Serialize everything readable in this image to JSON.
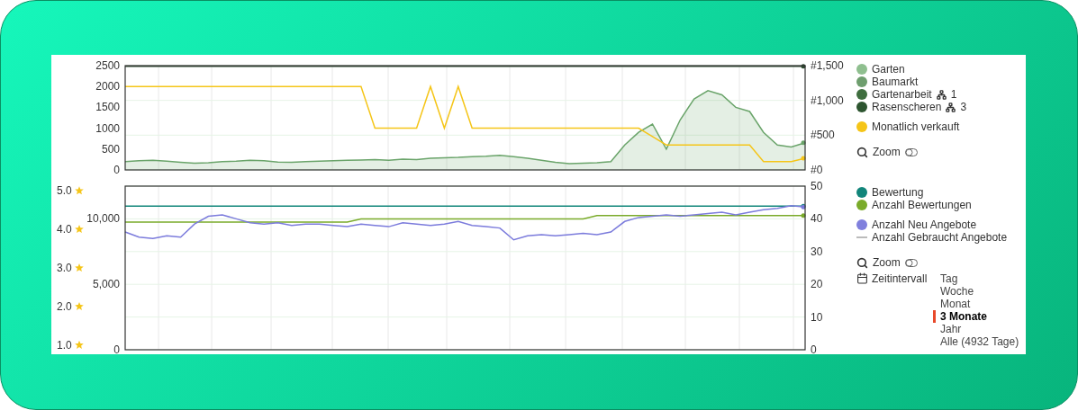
{
  "sales_chart": {
    "chart_data": {
      "type": "line",
      "grid": true,
      "ylim": [
        0,
        2500
      ],
      "yticks": [
        0,
        500,
        1000,
        1500,
        2000,
        2500
      ],
      "y2lim": [
        0,
        1500
      ],
      "y2ticks": [
        {
          "value": 0,
          "label": "#0"
        },
        {
          "value": 500,
          "label": "#500"
        },
        {
          "value": 1000,
          "label": "#1,000"
        },
        {
          "value": 1500,
          "label": "#1,500"
        }
      ],
      "series": [
        {
          "color": "#6aa46a",
          "type": "area",
          "values": [
            200,
            220,
            230,
            210,
            180,
            160,
            170,
            200,
            210,
            230,
            220,
            190,
            180,
            200,
            210,
            220,
            230,
            240,
            250,
            230,
            260,
            250,
            280,
            290,
            300,
            320,
            330,
            350,
            320,
            280,
            230,
            180,
            150,
            160,
            170,
            200,
            600,
            900,
            1100,
            500,
            1200,
            1700,
            1900,
            1800,
            1500,
            1400,
            900,
            600,
            550,
            650
          ]
        },
        {
          "color": "#2d4a30",
          "axis": "y2",
          "values": [
            1490,
            1490,
            1490,
            1490,
            1490,
            1490,
            1490,
            1490,
            1490,
            1490,
            1490,
            1490,
            1490,
            1490,
            1490,
            1490,
            1490,
            1490,
            1490,
            1490,
            1490,
            1490,
            1490,
            1490,
            1490,
            1490,
            1490,
            1490,
            1490,
            1490,
            1490,
            1490,
            1490,
            1490,
            1490,
            1490,
            1490,
            1490,
            1490,
            1490,
            1490,
            1490,
            1490,
            1490,
            1490,
            1490,
            1490,
            1490,
            1490,
            1490
          ]
        },
        {
          "color": "#f5c518",
          "values": [
            2000,
            2000,
            2000,
            2000,
            2000,
            2000,
            2000,
            2000,
            2000,
            2000,
            2000,
            2000,
            2000,
            2000,
            2000,
            2000,
            2000,
            2000,
            1000,
            1000,
            1000,
            1000,
            2000,
            1000,
            2000,
            1000,
            1000,
            1000,
            1000,
            1000,
            1000,
            1000,
            1000,
            1000,
            1000,
            1000,
            1000,
            1000,
            800,
            600,
            600,
            600,
            600,
            600,
            600,
            600,
            200,
            200,
            200,
            280
          ]
        }
      ]
    }
  },
  "sales_legend": {
    "groups": [
      [
        {
          "label": "Garten",
          "color": "#8fbf8f"
        },
        {
          "label": "Baumarkt",
          "color": "#6e9e6e"
        },
        {
          "label": "Gartenarbeit",
          "color": "#3f6e3f",
          "count": "1"
        },
        {
          "label": "Rasenscheren",
          "color": "#2d5530",
          "count": "3"
        }
      ],
      [
        {
          "label": "Monatlich verkauft",
          "color": "#f5c518"
        }
      ]
    ],
    "zoom": {
      "label": "Zoom",
      "on": false
    }
  },
  "offers_chart": {
    "chart_data": {
      "type": "line",
      "grid": true,
      "ylim": [
        0,
        12500
      ],
      "yticks": [
        0,
        {
          "value": 5000,
          "label": "5,000"
        },
        {
          "value": 10000,
          "label": "10,000"
        }
      ],
      "y2lim": [
        0,
        50
      ],
      "y2ticks": [
        0,
        10,
        20,
        30,
        40,
        50
      ],
      "y3lim": [
        0.88,
        5.12
      ],
      "y3ticks": [
        {
          "value": 1,
          "label": "1.0"
        },
        {
          "value": 2,
          "label": "2.0"
        },
        {
          "value": 3,
          "label": "3.0"
        },
        {
          "value": 4,
          "label": "4.0"
        },
        {
          "value": 5,
          "label": "5.0"
        }
      ],
      "series": [
        {
          "color": "#11857a",
          "axis": "y3",
          "values": [
            4.6,
            4.6,
            4.6,
            4.6,
            4.6,
            4.6,
            4.6,
            4.6,
            4.6,
            4.6,
            4.6,
            4.6,
            4.6,
            4.6,
            4.6,
            4.6,
            4.6,
            4.6,
            4.6,
            4.6,
            4.6,
            4.6,
            4.6,
            4.6,
            4.6,
            4.6,
            4.6,
            4.6,
            4.6,
            4.6,
            4.6,
            4.6,
            4.6,
            4.6,
            4.6,
            4.6,
            4.6,
            4.6,
            4.6,
            4.6,
            4.6,
            4.6,
            4.6,
            4.6,
            4.6,
            4.6,
            4.6,
            4.6,
            4.6,
            4.6
          ]
        },
        {
          "color": "#7aab2a",
          "axis": "y2",
          "values": [
            39,
            39,
            39,
            39,
            39,
            39,
            39,
            39,
            39,
            39,
            39,
            39,
            39,
            39,
            39,
            39,
            39,
            40,
            40,
            40,
            40,
            40,
            40,
            40,
            40,
            40,
            40,
            40,
            40,
            40,
            40,
            40,
            40,
            40,
            41,
            41,
            41,
            41,
            41,
            41,
            41,
            41,
            41,
            41,
            41,
            41,
            41,
            41,
            41,
            41
          ]
        },
        {
          "color": "#7b7bdc",
          "values": [
            9000,
            8600,
            8500,
            8700,
            8600,
            9600,
            10200,
            10300,
            10000,
            9700,
            9600,
            9700,
            9500,
            9600,
            9600,
            9500,
            9400,
            9600,
            9500,
            9400,
            9700,
            9600,
            9500,
            9600,
            9800,
            9500,
            9400,
            9300,
            8400,
            8700,
            8800,
            8700,
            8800,
            8900,
            8800,
            9000,
            9800,
            10100,
            10200,
            10300,
            10200,
            10300,
            10400,
            10500,
            10300,
            10500,
            10700,
            10800,
            11000,
            10900
          ]
        }
      ]
    }
  },
  "offers_legend": {
    "groups": [
      [
        {
          "label": "Bewertung",
          "kind": "dot",
          "color": "#11857a"
        },
        {
          "label": "Anzahl Bewertungen",
          "kind": "dot",
          "color": "#7aab2a"
        }
      ],
      [
        {
          "label": "Anzahl Neu Angebote",
          "kind": "dot",
          "color": "#8080dd"
        },
        {
          "label": "Anzahl Gebraucht Angebote",
          "kind": "line",
          "color": "#bbbbbb"
        }
      ]
    ],
    "zoom": {
      "label": "Zoom",
      "on": false
    },
    "interval": {
      "label": "Zeitintervall",
      "options": [
        {
          "label": "Tag",
          "selected": false
        },
        {
          "label": "Woche",
          "selected": false
        },
        {
          "label": "Monat",
          "selected": false
        },
        {
          "label": "3 Monate",
          "selected": true
        },
        {
          "label": "Jahr",
          "selected": false
        },
        {
          "label": "Alle (4932 Tage)",
          "selected": false
        }
      ]
    }
  }
}
